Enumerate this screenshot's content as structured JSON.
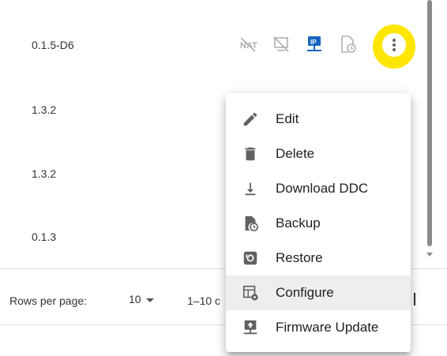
{
  "table": {
    "rows": [
      {
        "version": "0.1.5-D6"
      },
      {
        "version": "1.3.2"
      },
      {
        "version": "1.3.2"
      },
      {
        "version": "0.1.3"
      }
    ],
    "status_icons": [
      "nat-off-icon",
      "monitor-off-icon",
      "ip-network-icon",
      "backup-clock-icon"
    ],
    "row_actions": {
      "icon": "more-vert-icon",
      "highlight_color": "#ffe600"
    }
  },
  "pagination": {
    "rows_per_page_label": "Rows per page:",
    "rows_per_page_value": "10",
    "range_text": "1–10 c"
  },
  "context_menu": {
    "items": [
      {
        "label": "Edit",
        "icon": "pencil-icon"
      },
      {
        "label": "Delete",
        "icon": "trash-icon"
      },
      {
        "label": "Download DDC",
        "icon": "download-icon"
      },
      {
        "label": "Backup",
        "icon": "backup-file-icon"
      },
      {
        "label": "Restore",
        "icon": "restore-icon"
      },
      {
        "label": "Configure",
        "icon": "configure-icon",
        "highlighted": true
      },
      {
        "label": "Firmware Update",
        "icon": "firmware-update-icon"
      }
    ]
  },
  "colors": {
    "accent": "#1565c0",
    "icon_gray": "#5f6368",
    "disabled_gray": "#b0b0b0"
  }
}
